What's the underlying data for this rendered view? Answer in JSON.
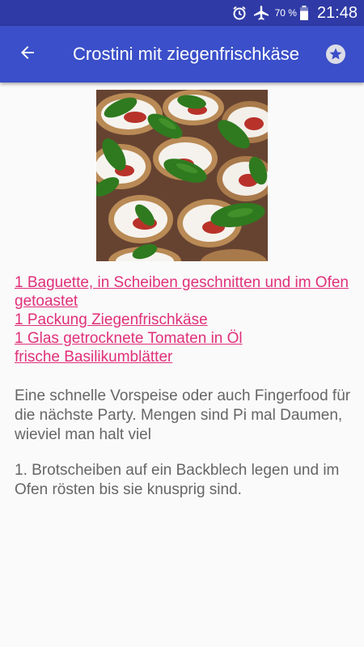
{
  "status_bar": {
    "battery_percent": "70 %",
    "time": "21:48",
    "icons": [
      "alarm-icon",
      "airplane-mode-icon",
      "battery-icon"
    ]
  },
  "app_bar": {
    "title": "Crostini mit ziegenfrischkäse",
    "back_icon": "arrow-left-icon",
    "favorite_icon": "star-circle-icon"
  },
  "recipe": {
    "image_alt": "Crostini mit Ziegenfrischkäse, getrockneten Tomaten und Basilikum",
    "ingredients": [
      "1 Baguette, in Scheiben geschnitten und im Ofen getoastet",
      "1 Packung Ziegenfrischkäse",
      "1 Glas getrocknete Tomaten in Öl",
      "frische Basilikumblätter"
    ],
    "description": "Eine schnelle Vorspeise oder auch Fingerfood für die nächste Party. Mengen sind Pi mal Daumen, wieviel man halt viel",
    "steps": [
      "1. Brotscheiben auf ein Backblech legen und im Ofen rösten bis sie knusprig sind."
    ]
  },
  "colors": {
    "status_bar": "#2f3aa6",
    "app_bar": "#3a4fc9",
    "link": "#e0307a",
    "body_text": "#666666",
    "background": "#fafafa"
  }
}
